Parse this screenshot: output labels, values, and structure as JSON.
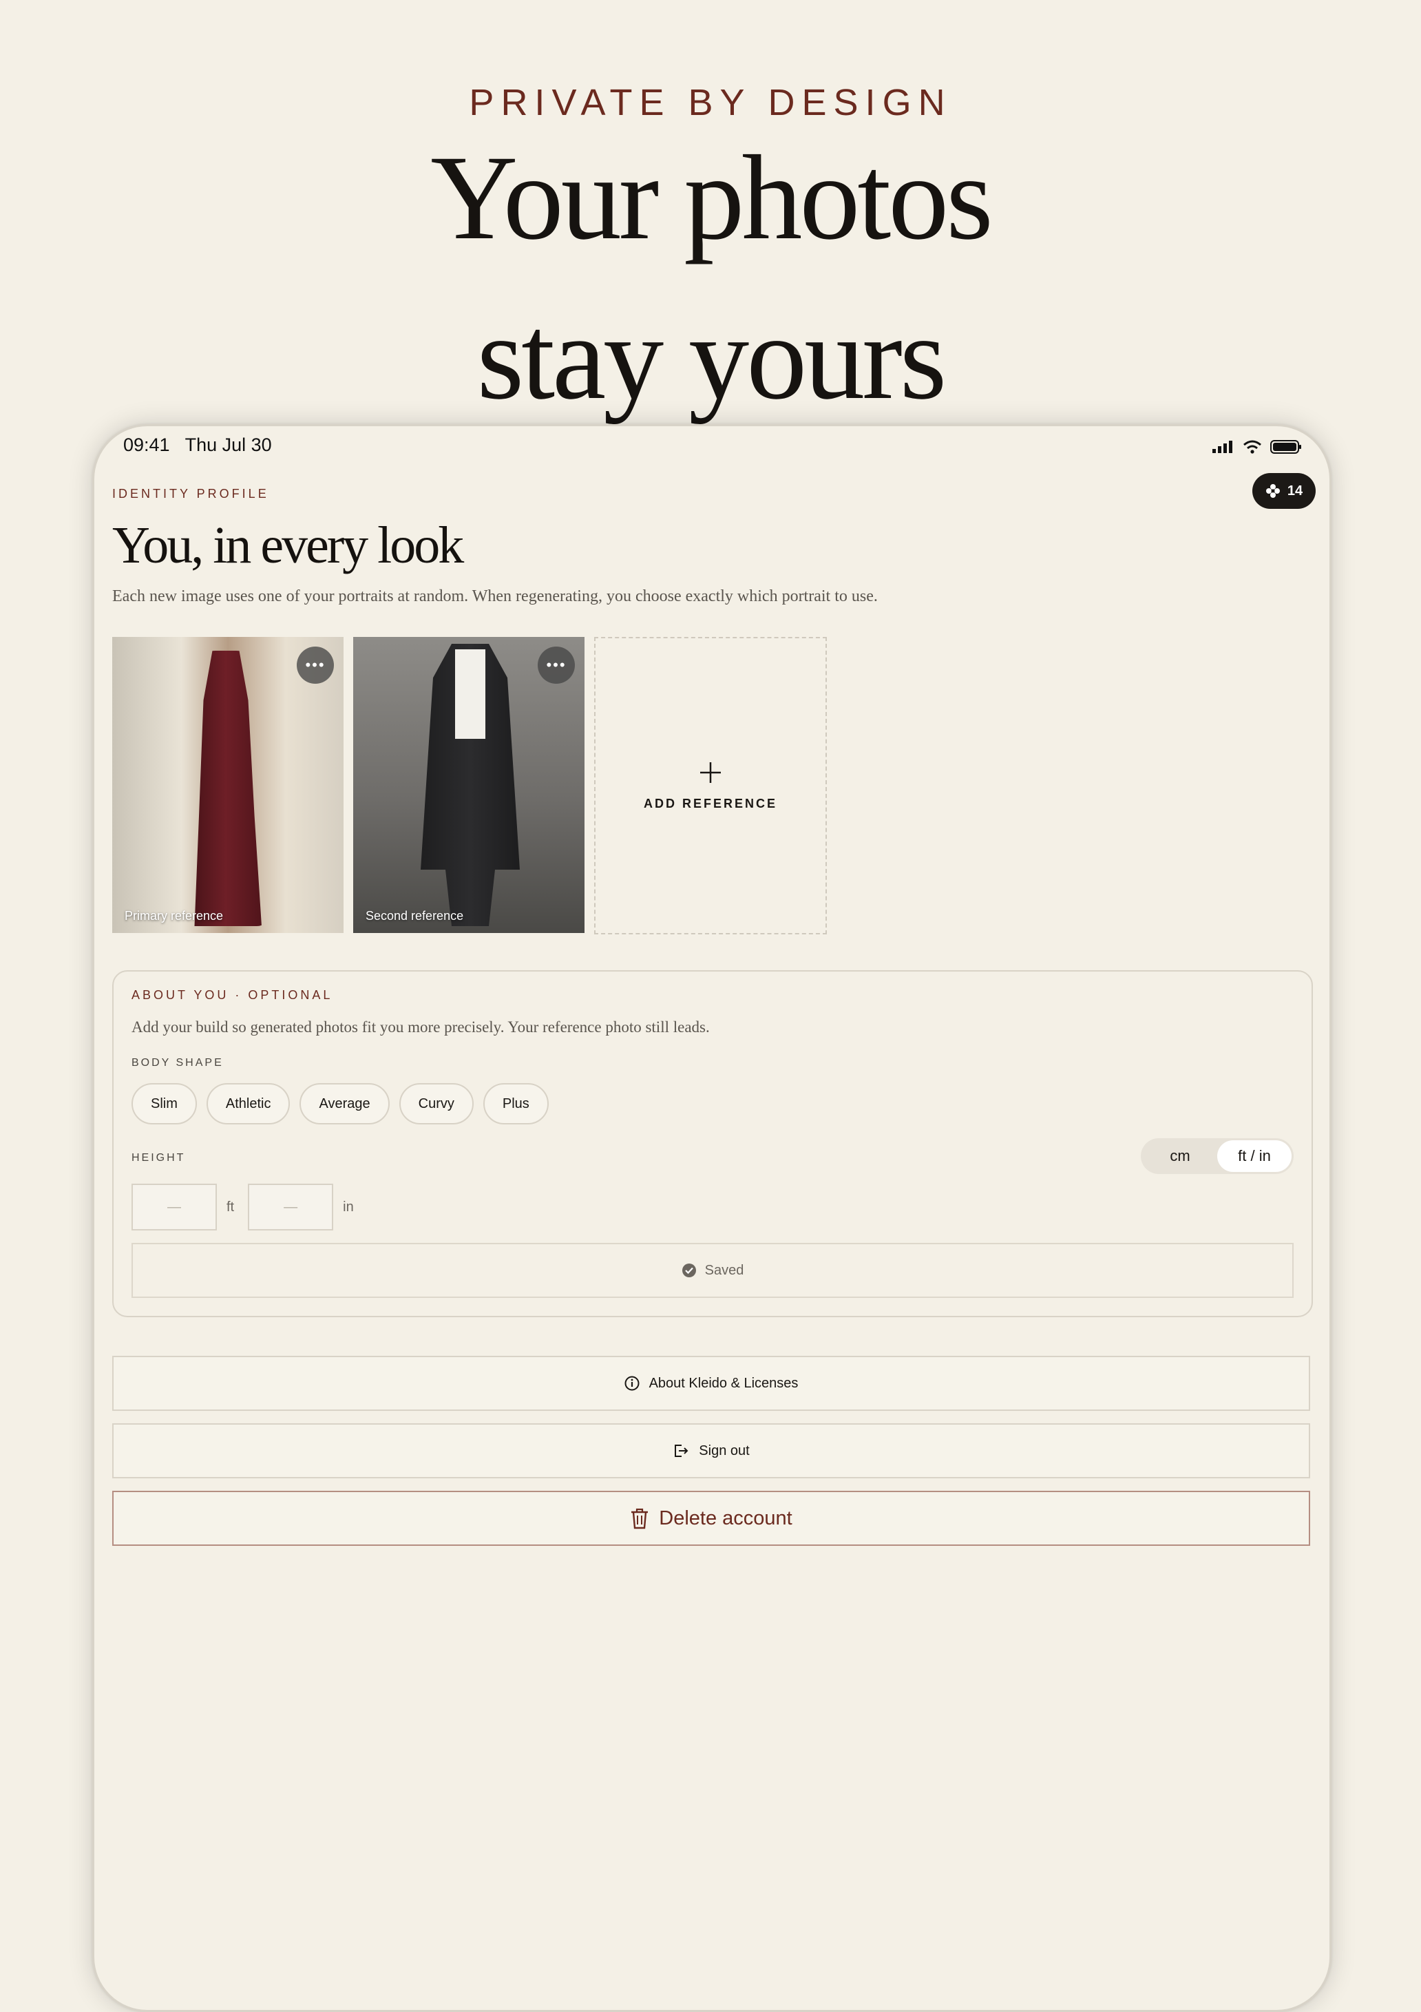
{
  "hero": {
    "eyebrow": "PRIVATE BY DESIGN",
    "title_line1": "Your photos",
    "title_line2": "stay yours"
  },
  "status_bar": {
    "time": "09:41",
    "date": "Thu Jul 30"
  },
  "credits_badge": {
    "count": "14",
    "icon": "flower-icon"
  },
  "profile": {
    "eyebrow": "IDENTITY PROFILE",
    "title": "You, in every look",
    "subtitle": "Each new image uses one of your portraits at random. When regenerating, you choose exactly which portrait to use."
  },
  "references": [
    {
      "caption": "Primary reference"
    },
    {
      "caption": "Second reference"
    }
  ],
  "add_reference_label": "ADD REFERENCE",
  "about": {
    "eyebrow": "ABOUT YOU · OPTIONAL",
    "subtitle": "Add your build so generated photos fit you more precisely. Your reference photo still leads.",
    "body_shape_label": "BODY SHAPE",
    "body_shapes": [
      "Slim",
      "Athletic",
      "Average",
      "Curvy",
      "Plus"
    ],
    "height_label": "HEIGHT",
    "units": [
      "cm",
      "ft / in"
    ],
    "selected_unit": "ft / in",
    "feet_placeholder": "—",
    "feet_unit": "ft",
    "inches_placeholder": "—",
    "inches_unit": "in",
    "saved_text": "Saved"
  },
  "actions": {
    "about": "About Kleido & Licenses",
    "sign_out": "Sign out",
    "delete": "Delete account"
  },
  "colors": {
    "background": "#f4f0e6",
    "accent": "#6b2a1f",
    "text": "#1a1714"
  }
}
